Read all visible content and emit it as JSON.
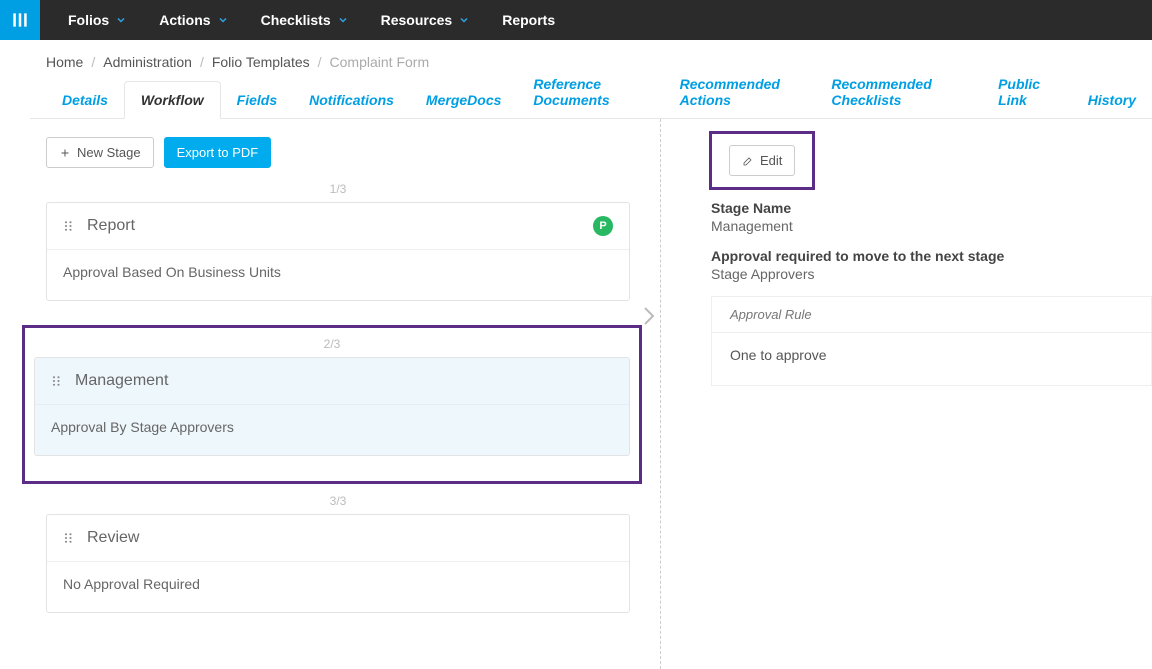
{
  "nav": {
    "items": [
      {
        "label": "Folios",
        "caret": true
      },
      {
        "label": "Actions",
        "caret": true
      },
      {
        "label": "Checklists",
        "caret": true
      },
      {
        "label": "Resources",
        "caret": true
      },
      {
        "label": "Reports",
        "caret": false
      }
    ]
  },
  "breadcrumb": {
    "items": [
      {
        "label": "Home",
        "current": false
      },
      {
        "label": "Administration",
        "current": false
      },
      {
        "label": "Folio Templates",
        "current": false
      },
      {
        "label": "Complaint Form",
        "current": true
      }
    ]
  },
  "tabs": {
    "items": [
      {
        "label": "Details",
        "active": false
      },
      {
        "label": "Workflow",
        "active": true
      },
      {
        "label": "Fields",
        "active": false
      },
      {
        "label": "Notifications",
        "active": false
      },
      {
        "label": "MergeDocs",
        "active": false
      },
      {
        "label": "Reference Documents",
        "active": false
      },
      {
        "label": "Recommended Actions",
        "active": false
      },
      {
        "label": "Recommended Checklists",
        "active": false
      },
      {
        "label": "Public Link",
        "active": false
      },
      {
        "label": "History",
        "active": false
      }
    ]
  },
  "toolbar": {
    "new_stage": "New Stage",
    "export_pdf": "Export to PDF"
  },
  "stages": [
    {
      "counter": "1/3",
      "title": "Report",
      "body": "Approval Based On Business Units",
      "badge": "P",
      "selected": false
    },
    {
      "counter": "2/3",
      "title": "Management",
      "body": "Approval By Stage Approvers",
      "badge": null,
      "selected": true
    },
    {
      "counter": "3/3",
      "title": "Review",
      "body": "No Approval Required",
      "badge": null,
      "selected": false
    }
  ],
  "details": {
    "edit_label": "Edit",
    "stage_name_label": "Stage Name",
    "stage_name_value": "Management",
    "approval_required_label": "Approval required to move to the next stage",
    "approval_required_value": "Stage Approvers",
    "approval_rule_header": "Approval Rule",
    "approval_rule_value": "One to approve"
  },
  "colors": {
    "accent": "#009fe3",
    "highlight": "#5b2d86",
    "success": "#28b862"
  }
}
